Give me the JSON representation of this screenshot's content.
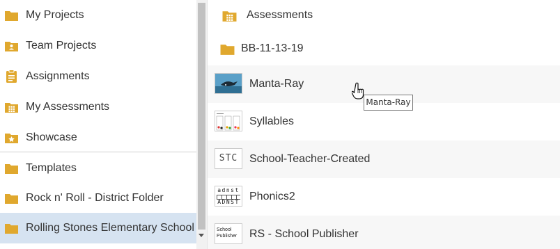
{
  "sidebar": {
    "items": [
      {
        "label": "My Projects",
        "icon": "folder-icon"
      },
      {
        "label": "Team Projects",
        "icon": "folder-person-icon"
      },
      {
        "label": "Assignments",
        "icon": "clipboard-icon"
      },
      {
        "label": "My Assessments",
        "icon": "folder-grid-icon"
      },
      {
        "label": "Showcase",
        "icon": "folder-star-icon"
      },
      {
        "label": "Templates",
        "icon": "folder-icon"
      },
      {
        "label": "Rock n' Roll - District Folder",
        "icon": "folder-icon"
      },
      {
        "label": "Rolling Stones Elementary School",
        "icon": "folder-icon",
        "selected": true
      }
    ]
  },
  "main": {
    "folders": [
      {
        "label": "Assessments",
        "icon": "folder-grid-icon"
      },
      {
        "label": "BB-11-13-19",
        "icon": "folder-icon"
      }
    ],
    "projects": [
      {
        "label": "Manta-Ray",
        "thumbnail": "manta-ray-thumbnail"
      },
      {
        "label": "Syllables",
        "thumbnail": "syllables-thumbnail"
      },
      {
        "label": "School-Teacher-Created",
        "thumbnail": "stc-thumbnail",
        "thumb_text": "STC"
      },
      {
        "label": "Phonics2",
        "thumbnail": "phonics-thumbnail",
        "thumb_top": "adnst",
        "thumb_bottom": "ADNST"
      },
      {
        "label": "RS - School Publisher",
        "thumbnail": "school-publisher-thumbnail",
        "thumb_text": "School Publisher"
      }
    ]
  },
  "tooltip": {
    "text": "Manta-Ray"
  },
  "colors": {
    "folder": "#E0A82E",
    "selected_bg": "#D6E3F1",
    "text": "#333333"
  }
}
